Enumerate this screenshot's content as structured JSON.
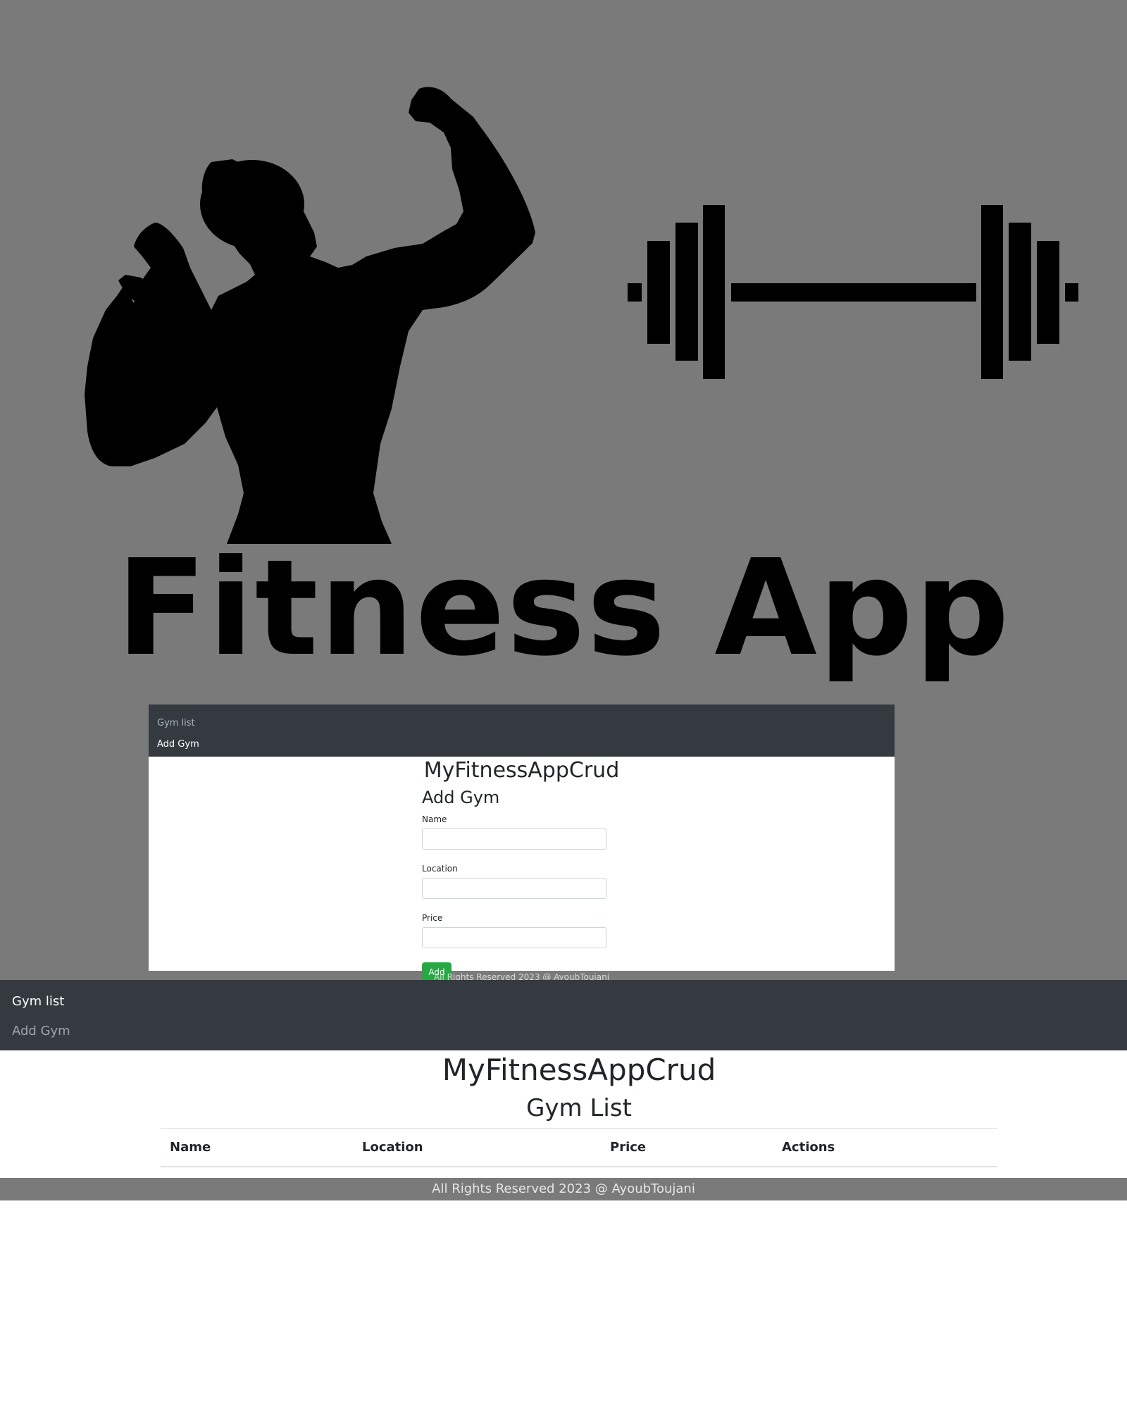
{
  "hero": {
    "title": "Fitness App",
    "background_color": "#7a7a7a"
  },
  "preview_card": {
    "nav": {
      "items": [
        {
          "label": "Gym list",
          "active": false
        },
        {
          "label": "Add Gym",
          "active": true
        }
      ]
    },
    "brand": "MyFitnessAppCrud",
    "form": {
      "title": "Add Gym",
      "fields": [
        {
          "label": "Name",
          "value": "",
          "placeholder": ""
        },
        {
          "label": "Location",
          "value": "",
          "placeholder": ""
        },
        {
          "label": "Price",
          "value": "",
          "placeholder": ""
        }
      ],
      "submit_label": "Add",
      "submit_color": "#28a745"
    },
    "footer": "All Rights Reserved 2023 @ AyoubToujani"
  },
  "navbar": {
    "items": [
      {
        "label": "Gym list",
        "active": true
      },
      {
        "label": "Add Gym",
        "active": false
      }
    ],
    "color": "#343a40"
  },
  "main": {
    "brand": "MyFitnessAppCrud",
    "section_title": "Gym List",
    "table": {
      "columns": [
        "Name",
        "Location",
        "Price",
        "Actions"
      ],
      "rows": []
    }
  },
  "footer": {
    "text": "All Rights Reserved 2023 @ AyoubToujani"
  }
}
